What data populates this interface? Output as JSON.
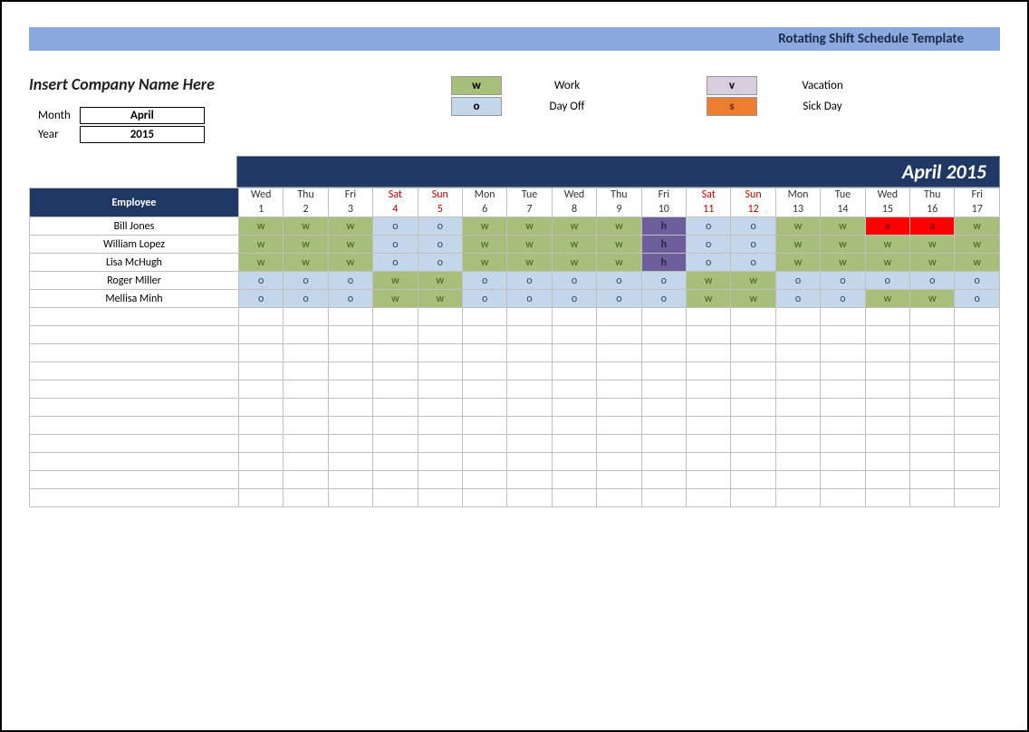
{
  "header": {
    "title": "Rotating Shift Schedule Template"
  },
  "company": {
    "name_placeholder": "Insert Company Name Here",
    "month_label": "Month",
    "month_value": "April",
    "year_label": "Year",
    "year_value": "2015"
  },
  "legend": {
    "w": {
      "code": "w",
      "label": "Work"
    },
    "o": {
      "code": "o",
      "label": "Day Off"
    },
    "v": {
      "code": "v",
      "label": "Vacation"
    },
    "s": {
      "code": "s",
      "label": "Sick Day"
    }
  },
  "period_title": "April 2015",
  "columns": {
    "employee": "Employee"
  },
  "days": [
    {
      "dow": "Wed",
      "num": "1",
      "weekend": false
    },
    {
      "dow": "Thu",
      "num": "2",
      "weekend": false
    },
    {
      "dow": "Fri",
      "num": "3",
      "weekend": false
    },
    {
      "dow": "Sat",
      "num": "4",
      "weekend": true
    },
    {
      "dow": "Sun",
      "num": "5",
      "weekend": true
    },
    {
      "dow": "Mon",
      "num": "6",
      "weekend": false
    },
    {
      "dow": "Tue",
      "num": "7",
      "weekend": false
    },
    {
      "dow": "Wed",
      "num": "8",
      "weekend": false
    },
    {
      "dow": "Thu",
      "num": "9",
      "weekend": false
    },
    {
      "dow": "Fri",
      "num": "10",
      "weekend": false
    },
    {
      "dow": "Sat",
      "num": "11",
      "weekend": true
    },
    {
      "dow": "Sun",
      "num": "12",
      "weekend": true
    },
    {
      "dow": "Mon",
      "num": "13",
      "weekend": false
    },
    {
      "dow": "Tue",
      "num": "14",
      "weekend": false
    },
    {
      "dow": "Wed",
      "num": "15",
      "weekend": false
    },
    {
      "dow": "Thu",
      "num": "16",
      "weekend": false
    },
    {
      "dow": "Fri",
      "num": "17",
      "weekend": false
    }
  ],
  "employees": [
    {
      "name": "Bill Jones",
      "shifts": [
        "w",
        "w",
        "w",
        "o",
        "o",
        "w",
        "w",
        "w",
        "w",
        "h",
        "o",
        "o",
        "w",
        "w",
        "a",
        "a",
        "w"
      ]
    },
    {
      "name": "William Lopez",
      "shifts": [
        "w",
        "w",
        "w",
        "o",
        "o",
        "w",
        "w",
        "w",
        "w",
        "h",
        "o",
        "o",
        "w",
        "w",
        "w",
        "w",
        "w"
      ]
    },
    {
      "name": "Lisa McHugh",
      "shifts": [
        "w",
        "w",
        "w",
        "o",
        "o",
        "w",
        "w",
        "w",
        "w",
        "h",
        "o",
        "o",
        "w",
        "w",
        "w",
        "w",
        "w"
      ]
    },
    {
      "name": "Roger Miller",
      "shifts": [
        "o",
        "o",
        "o",
        "w",
        "w",
        "o",
        "o",
        "o",
        "o",
        "o",
        "w",
        "w",
        "o",
        "o",
        "o",
        "o",
        "o"
      ]
    },
    {
      "name": "Mellisa Minh",
      "shifts": [
        "o",
        "o",
        "o",
        "w",
        "w",
        "o",
        "o",
        "o",
        "o",
        "o",
        "w",
        "w",
        "o",
        "o",
        "w",
        "w",
        "o"
      ]
    }
  ],
  "empty_rows": 11
}
